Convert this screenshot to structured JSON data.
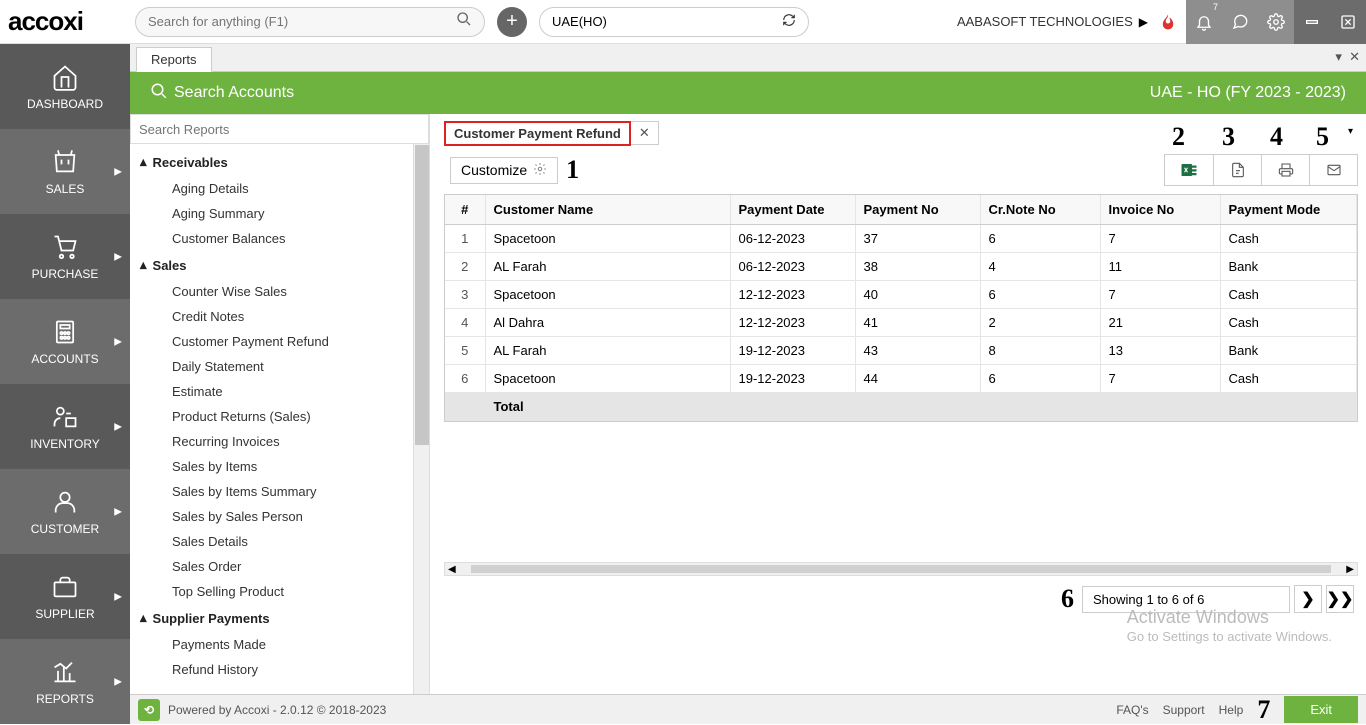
{
  "logo": "accoxi",
  "search_placeholder": "Search for anything (F1)",
  "branch": "UAE(HO)",
  "company": "AABASOFT TECHNOLOGIES",
  "notification_count": "7",
  "sidebar": {
    "items": [
      {
        "label": "DASHBOARD"
      },
      {
        "label": "SALES"
      },
      {
        "label": "PURCHASE"
      },
      {
        "label": "ACCOUNTS"
      },
      {
        "label": "INVENTORY"
      },
      {
        "label": "CUSTOMER"
      },
      {
        "label": "SUPPLIER"
      },
      {
        "label": "REPORTS"
      }
    ]
  },
  "main_tab": "Reports",
  "green_bar": {
    "title": "Search Accounts",
    "context": "UAE - HO (FY 2023 - 2023)"
  },
  "search_reports_placeholder": "Search Reports",
  "tree": {
    "group1": "Receivables",
    "items1": [
      "Aging Details",
      "Aging Summary",
      "Customer Balances"
    ],
    "group2": "Sales",
    "items2": [
      "Counter Wise Sales",
      "Credit Notes",
      "Customer Payment Refund",
      "Daily Statement",
      "Estimate",
      "Product Returns (Sales)",
      "Recurring Invoices",
      "Sales by Items",
      "Sales by Items Summary",
      "Sales by Sales Person",
      "Sales Details",
      "Sales Order",
      "Top Selling Product"
    ],
    "group3": "Supplier Payments",
    "items3": [
      "Payments Made",
      "Refund History"
    ]
  },
  "report_tab": "Customer Payment Refund",
  "customize_label": "Customize",
  "table": {
    "headers": [
      "#",
      "Customer Name",
      "Payment Date",
      "Payment No",
      "Cr.Note No",
      "Invoice No",
      "Payment Mode"
    ],
    "rows": [
      {
        "idx": "1",
        "name": "Spacetoon",
        "date": "06-12-2023",
        "pay": "37",
        "cr": "6",
        "inv": "7",
        "mode": "Cash"
      },
      {
        "idx": "2",
        "name": "AL Farah",
        "date": "06-12-2023",
        "pay": "38",
        "cr": "4",
        "inv": "11",
        "mode": "Bank"
      },
      {
        "idx": "3",
        "name": "Spacetoon",
        "date": "12-12-2023",
        "pay": "40",
        "cr": "6",
        "inv": "7",
        "mode": "Cash"
      },
      {
        "idx": "4",
        "name": "Al Dahra",
        "date": "12-12-2023",
        "pay": "41",
        "cr": "2",
        "inv": "21",
        "mode": "Cash"
      },
      {
        "idx": "5",
        "name": "AL Farah",
        "date": "19-12-2023",
        "pay": "43",
        "cr": "8",
        "inv": "13",
        "mode": "Bank"
      },
      {
        "idx": "6",
        "name": "Spacetoon",
        "date": "19-12-2023",
        "pay": "44",
        "cr": "6",
        "inv": "7",
        "mode": "Cash"
      }
    ],
    "total_label": "Total"
  },
  "pagination": "Showing 1 to 6 of 6",
  "callouts": {
    "c1": "1",
    "c2": "2",
    "c3": "3",
    "c4": "4",
    "c5": "5",
    "c6": "6",
    "c7": "7"
  },
  "watermark": {
    "title": "Activate Windows",
    "sub": "Go to Settings to activate Windows."
  },
  "footer": {
    "powered": "Powered by Accoxi - 2.0.12 © 2018-2023",
    "links": [
      "FAQ's",
      "Support",
      "Help"
    ],
    "exit": "Exit"
  }
}
